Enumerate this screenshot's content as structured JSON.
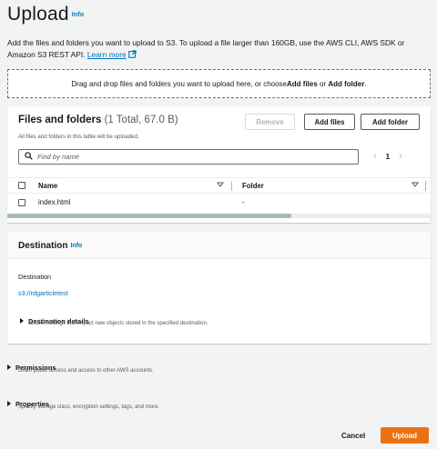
{
  "header": {
    "title": "Upload",
    "info": "Info",
    "description": "Add the files and folders you want to upload to S3. To upload a file larger than 160GB, use the AWS CLI, AWS SDK or Amazon S3 REST API.",
    "learn_more": "Learn more"
  },
  "dropzone": {
    "text_before": "Drag and drop files and folders you want to upload here, or choose ",
    "add_files": "Add files",
    "or": " or ",
    "add_folder": "Add folder",
    "end": "."
  },
  "files_panel": {
    "title": "Files and folders",
    "count": "(1 Total, 67.0 B)",
    "subtitle": "All files and folders in this table will be uploaded.",
    "remove_button": "Remove",
    "add_files_button": "Add files",
    "add_folder_button": "Add folder",
    "search_placeholder": "Find by name",
    "pagination": {
      "current_page": "1",
      "prev": "‹",
      "next": "›"
    },
    "columns": [
      "Name",
      "Folder"
    ],
    "rows": [
      {
        "name": "index.html",
        "folder": "-"
      }
    ],
    "horizontal_scroll_fraction": 0.67
  },
  "destination": {
    "title": "Destination",
    "info": "Info",
    "label": "Destination",
    "value": "s3://rdgarticletest",
    "details_title": "Destination details",
    "details_sub": "Bucket settings that impact new objects stored in the specified destination."
  },
  "permissions": {
    "title": "Permissions",
    "sub": "Grant public access and access to other AWS accounts."
  },
  "properties": {
    "title": "Properties",
    "sub": "Specify storage class, encryption settings, tags, and more."
  },
  "footer": {
    "cancel": "Cancel",
    "upload": "Upload"
  },
  "colors": {
    "primary_button": "#ec7211",
    "link": "#0073bb",
    "background": "#f2f3f3"
  }
}
